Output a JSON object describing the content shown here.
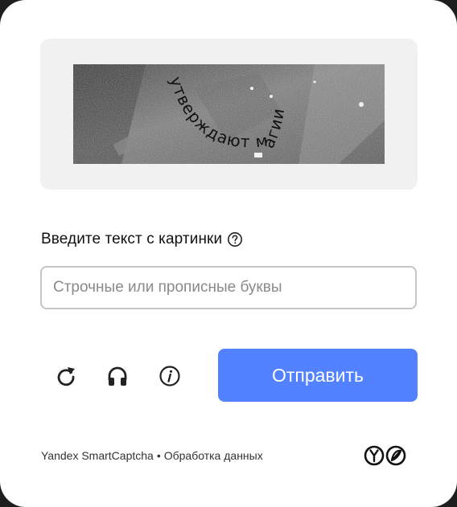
{
  "captcha": {
    "image_text": "утверждают магии"
  },
  "form": {
    "prompt_label": "Введите текст с картинки",
    "input_placeholder": "Строчные или прописные буквы",
    "input_value": "",
    "submit_label": "Отправить"
  },
  "icons": {
    "help": "question-circle-icon",
    "refresh": "refresh-icon",
    "audio": "headphones-icon",
    "info": "info-icon",
    "brand": "yandex-smartcaptcha-logo"
  },
  "footer": {
    "brand_link": "Yandex SmartCaptcha",
    "separator": "•",
    "privacy_link": "Обработка данных"
  },
  "colors": {
    "accent": "#5282ff",
    "panel": "#f1f1f1",
    "input_border": "#c5c5c5"
  }
}
